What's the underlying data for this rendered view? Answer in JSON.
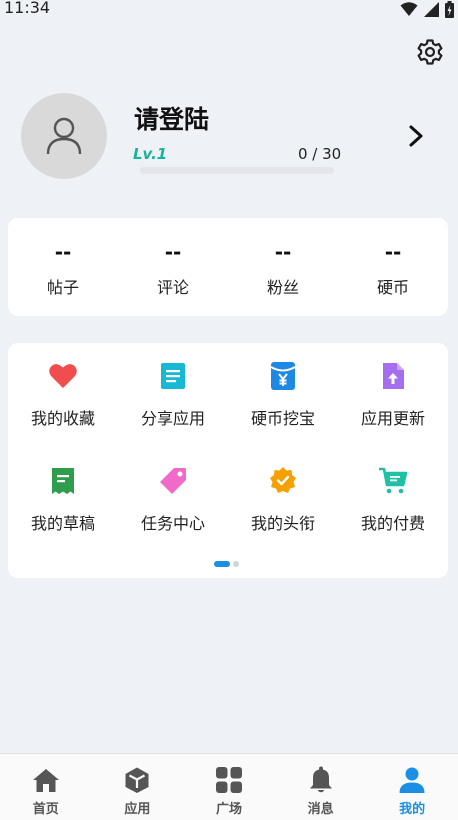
{
  "status_bar": {
    "time": "11:34"
  },
  "profile": {
    "name": "请登陆",
    "level": "Lv.1",
    "exp_text": "0 / 30",
    "exp_progress": 0,
    "accent_color": "#17b39a"
  },
  "stats": [
    {
      "value": "--",
      "label": "帖子"
    },
    {
      "value": "--",
      "label": "评论"
    },
    {
      "value": "--",
      "label": "粉丝"
    },
    {
      "value": "--",
      "label": "硬币"
    }
  ],
  "features": [
    {
      "label": "我的收藏",
      "icon": "heart-icon",
      "color": "#f04e4e"
    },
    {
      "label": "分享应用",
      "icon": "document-icon",
      "color": "#17b8d4"
    },
    {
      "label": "硬币挖宝",
      "icon": "coin-envelope-icon",
      "color": "#1e88e5"
    },
    {
      "label": "应用更新",
      "icon": "file-upload-icon",
      "color": "#a56ef0"
    },
    {
      "label": "我的草稿",
      "icon": "draft-receipt-icon",
      "color": "#2e9e4e"
    },
    {
      "label": "任务中心",
      "icon": "tag-icon",
      "color": "#f06bc9"
    },
    {
      "label": "我的头衔",
      "icon": "badge-check-icon",
      "color": "#f5a000"
    },
    {
      "label": "我的付费",
      "icon": "shopping-cart-icon",
      "color": "#1ec0a6"
    }
  ],
  "pager": {
    "page_count": 2,
    "current": 1
  },
  "tabs": [
    {
      "label": "首页",
      "icon": "home-icon",
      "active": false
    },
    {
      "label": "应用",
      "icon": "cube-icon",
      "active": false
    },
    {
      "label": "广场",
      "icon": "grid-icon",
      "active": false
    },
    {
      "label": "消息",
      "icon": "bell-icon",
      "active": false
    },
    {
      "label": "我的",
      "icon": "person-icon",
      "active": true
    }
  ],
  "colors": {
    "tab_active": "#1a8fe3",
    "tab_inactive": "#555555"
  }
}
